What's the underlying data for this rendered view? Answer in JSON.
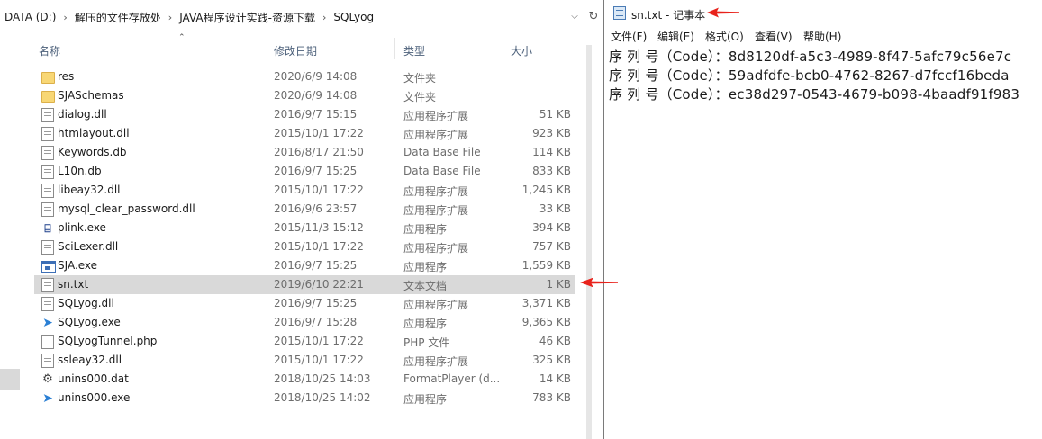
{
  "explorer": {
    "breadcrumb": [
      "DATA (D:)",
      "解压的文件存放处",
      "JAVA程序设计实践-资源下载",
      "SQLyog"
    ],
    "columns": {
      "name": "名称",
      "date": "修改日期",
      "type": "类型",
      "size": "大小"
    },
    "files": [
      {
        "name": "res",
        "date": "2020/6/9 14:08",
        "type": "文件夹",
        "size": "",
        "icon": "folder-icon"
      },
      {
        "name": "SJASchemas",
        "date": "2020/6/9 14:08",
        "type": "文件夹",
        "size": "",
        "icon": "folder-icon"
      },
      {
        "name": "dialog.dll",
        "date": "2016/9/7 15:15",
        "type": "应用程序扩展",
        "size": "51 KB",
        "icon": "dll-file-icon"
      },
      {
        "name": "htmlayout.dll",
        "date": "2015/10/1 17:22",
        "type": "应用程序扩展",
        "size": "923 KB",
        "icon": "dll-file-icon"
      },
      {
        "name": "Keywords.db",
        "date": "2016/8/17 21:50",
        "type": "Data Base File",
        "size": "114 KB",
        "icon": "db-file-icon"
      },
      {
        "name": "L10n.db",
        "date": "2016/9/7 15:25",
        "type": "Data Base File",
        "size": "833 KB",
        "icon": "db-file-icon"
      },
      {
        "name": "libeay32.dll",
        "date": "2015/10/1 17:22",
        "type": "应用程序扩展",
        "size": "1,245 KB",
        "icon": "dll-file-icon"
      },
      {
        "name": "mysql_clear_password.dll",
        "date": "2016/9/6 23:57",
        "type": "应用程序扩展",
        "size": "33 KB",
        "icon": "dll-file-icon"
      },
      {
        "name": "plink.exe",
        "date": "2015/11/3 15:12",
        "type": "应用程序",
        "size": "394 KB",
        "icon": "putty-exe-icon"
      },
      {
        "name": "SciLexer.dll",
        "date": "2015/10/1 17:22",
        "type": "应用程序扩展",
        "size": "757 KB",
        "icon": "dll-file-icon"
      },
      {
        "name": "SJA.exe",
        "date": "2016/9/7 15:25",
        "type": "应用程序",
        "size": "1,559 KB",
        "icon": "window-exe-icon"
      },
      {
        "name": "sn.txt",
        "date": "2019/6/10 22:21",
        "type": "文本文档",
        "size": "1 KB",
        "icon": "text-file-icon",
        "selected": true
      },
      {
        "name": "SQLyog.dll",
        "date": "2016/9/7 15:25",
        "type": "应用程序扩展",
        "size": "3,371 KB",
        "icon": "dll-file-icon"
      },
      {
        "name": "SQLyog.exe",
        "date": "2016/9/7 15:28",
        "type": "应用程序",
        "size": "9,365 KB",
        "icon": "dolphin-exe-icon"
      },
      {
        "name": "SQLyogTunnel.php",
        "date": "2015/10/1 17:22",
        "type": "PHP 文件",
        "size": "46 KB",
        "icon": "blank-file-icon"
      },
      {
        "name": "ssleay32.dll",
        "date": "2015/10/1 17:22",
        "type": "应用程序扩展",
        "size": "325 KB",
        "icon": "dll-file-icon"
      },
      {
        "name": "unins000.dat",
        "date": "2018/10/25 14:03",
        "type": "FormatPlayer (d...",
        "size": "14 KB",
        "icon": "dat-file-icon"
      },
      {
        "name": "unins000.exe",
        "date": "2018/10/25 14:02",
        "type": "应用程序",
        "size": "783 KB",
        "icon": "dolphin-exe-icon"
      }
    ]
  },
  "notepad": {
    "title": "sn.txt - 记事本",
    "menu": [
      "文件(F)",
      "编辑(E)",
      "格式(O)",
      "查看(V)",
      "帮助(H)"
    ],
    "lines": [
      "序 列 号（Code）：8d8120df-a5c3-4989-8f47-5afc79c56e7c",
      "序 列 号（Code）：59adfdfe-bcb0-4762-8267-d7fccf16beda",
      "序 列 号（Code）：ec38d297-0543-4679-b098-4baadf91f983"
    ]
  },
  "colors": {
    "arrow": "#e8221b",
    "selection": "#d9d9d9",
    "header_text": "#4c607a"
  }
}
